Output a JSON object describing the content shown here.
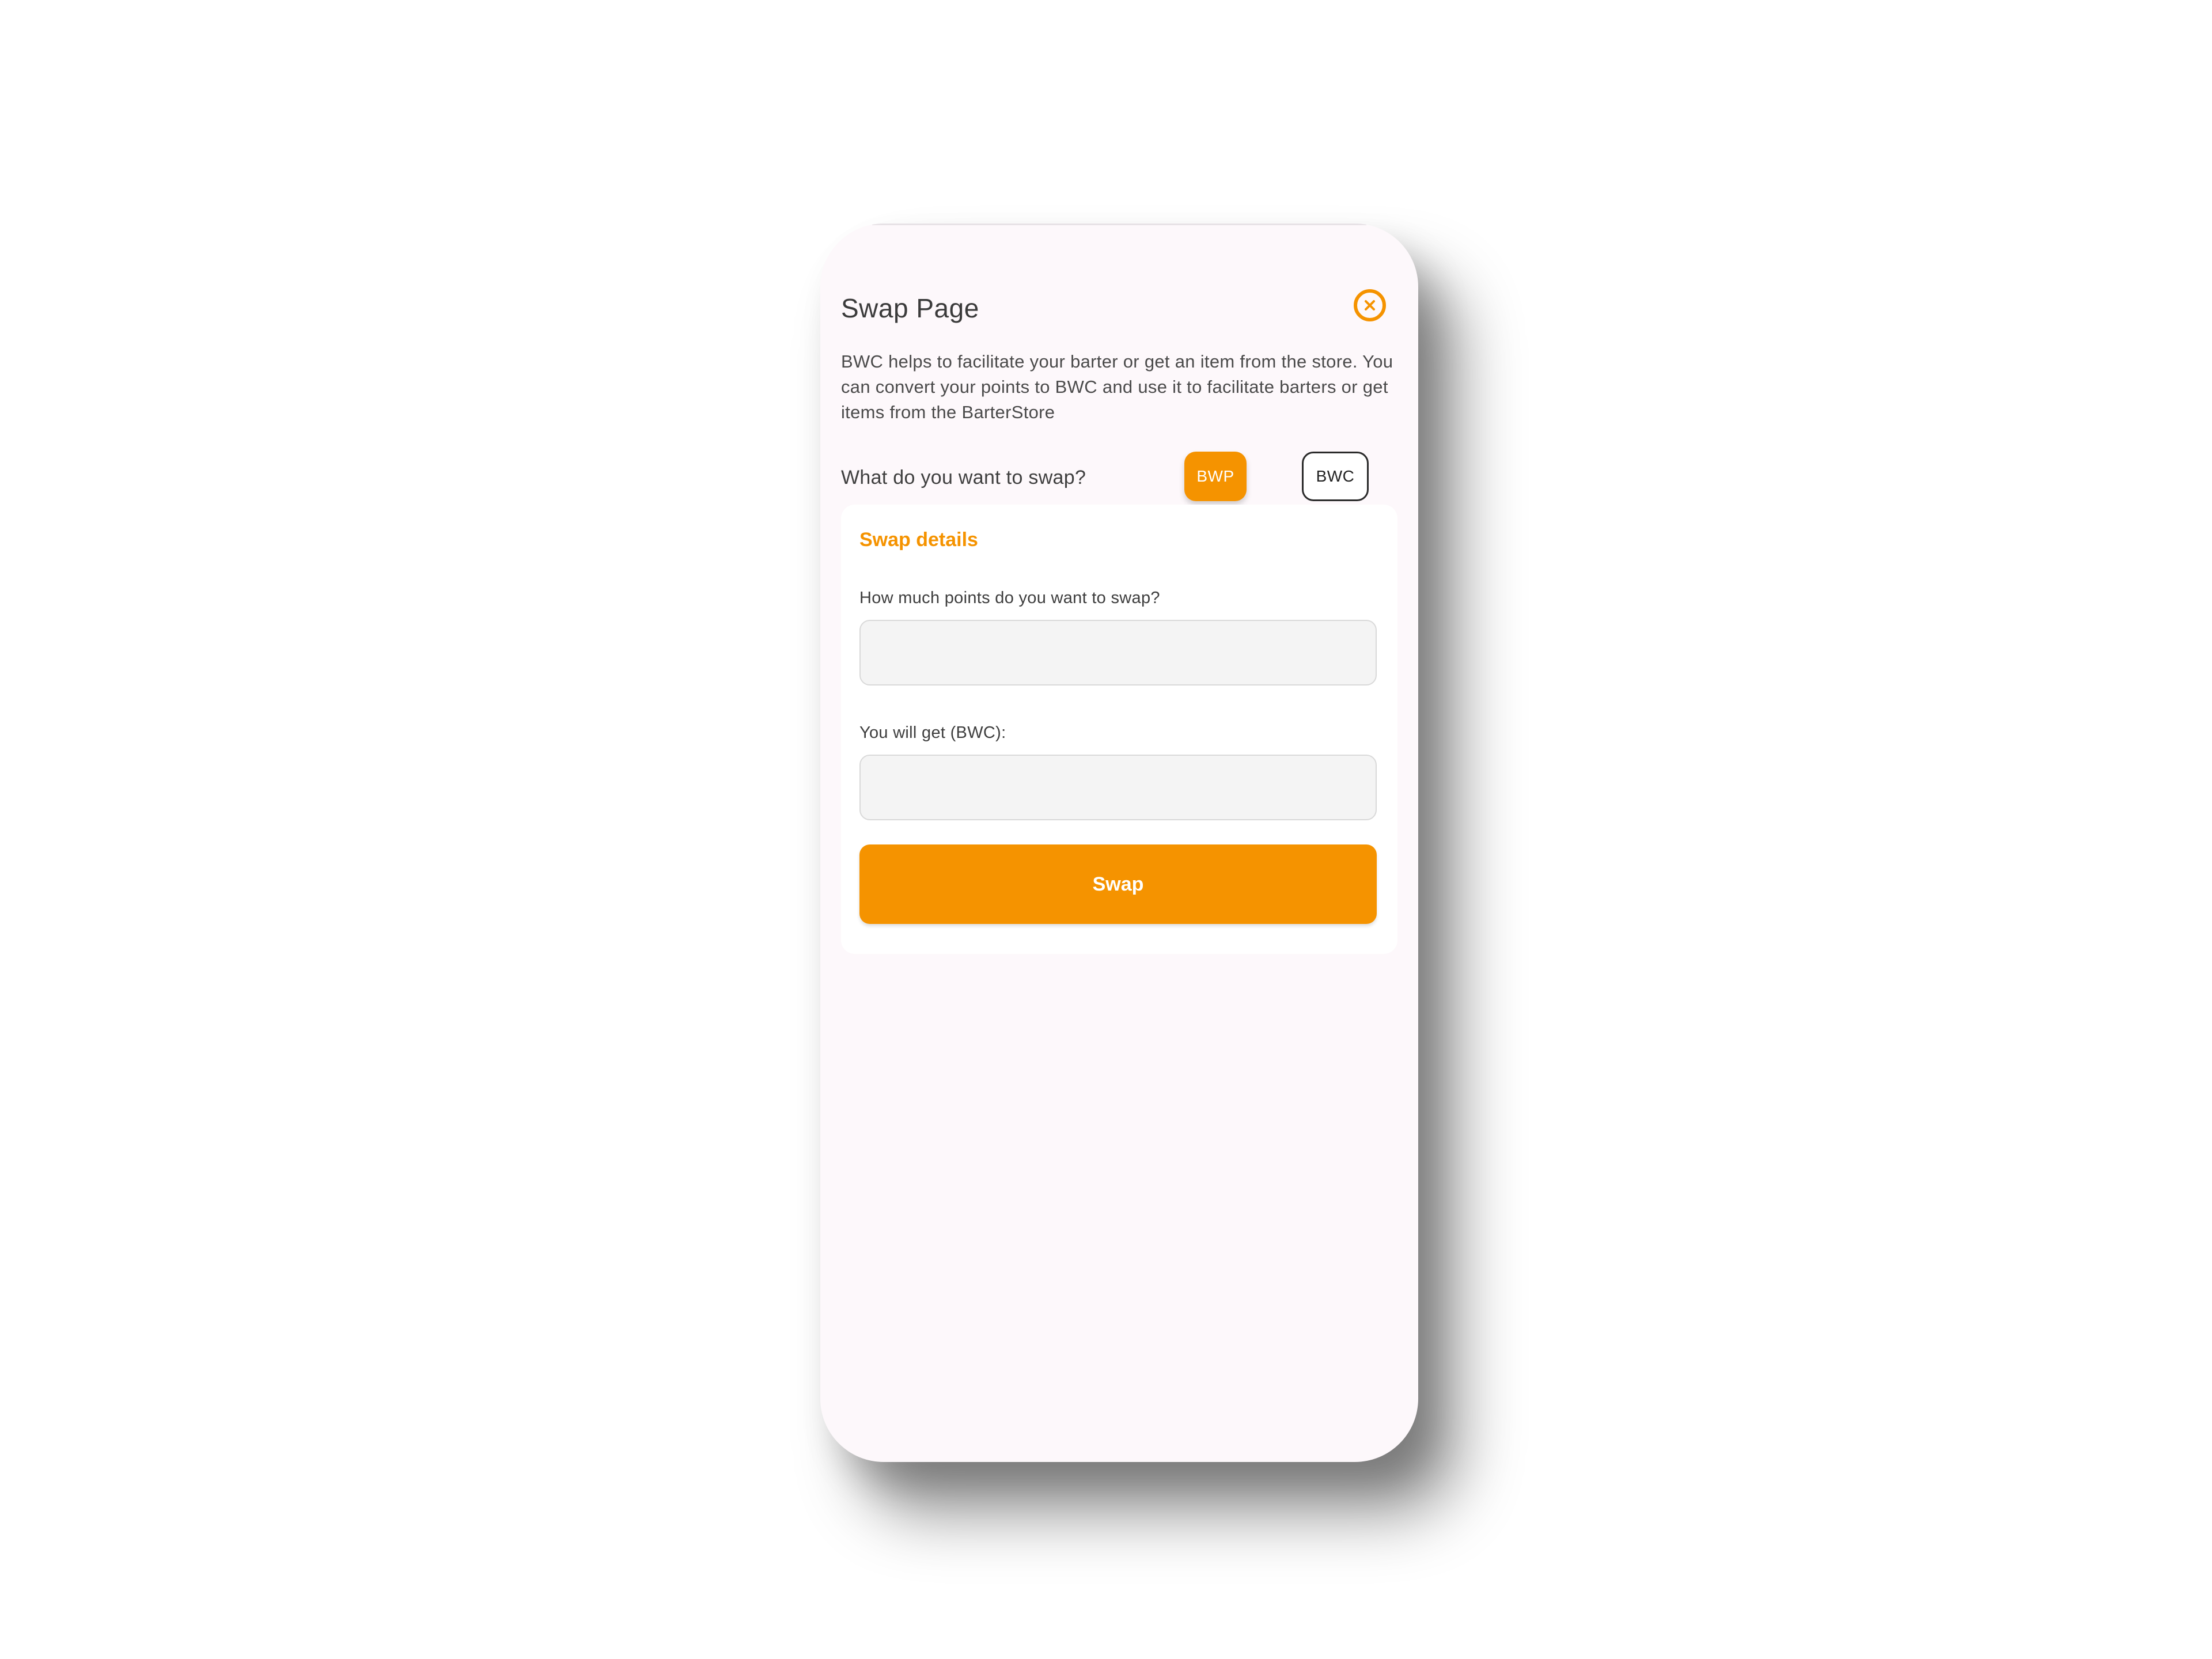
{
  "header": {
    "title": "Swap Page",
    "close_icon": "close-icon"
  },
  "description": "BWC helps to facilitate your barter or get an item from the store. You can convert your points to BWC and use it to facilitate barters or get items from the BarterStore",
  "swap_choice": {
    "question": "What do you want to swap?",
    "options": [
      {
        "label": "BWP",
        "selected": true
      },
      {
        "label": "BWC",
        "selected": false
      }
    ]
  },
  "details": {
    "title": "Swap details",
    "points_label": "How much points do you want to swap?",
    "points_value": "",
    "points_placeholder": "",
    "get_label": "You will get (BWC):",
    "get_value": "",
    "get_placeholder": "",
    "swap_button": "Swap"
  },
  "colors": {
    "accent": "#f59300",
    "background": "#fdf8fb",
    "card": "#ffffff",
    "field": "#f4f4f4"
  }
}
